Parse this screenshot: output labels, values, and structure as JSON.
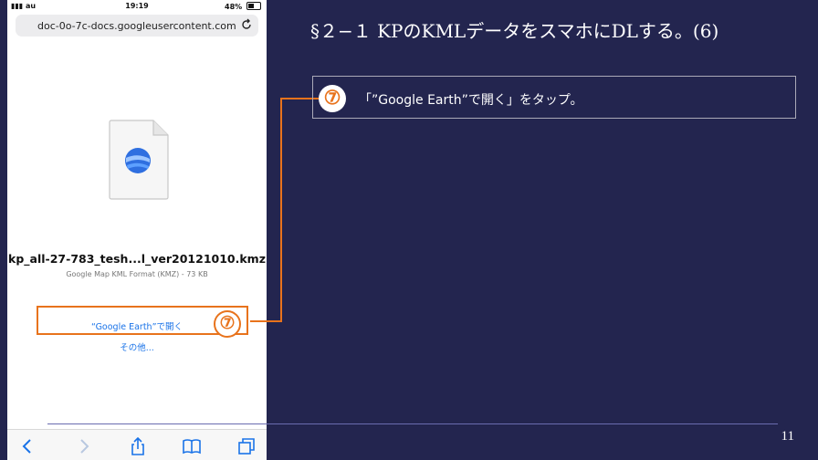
{
  "phone": {
    "status": {
      "carrier": "au",
      "time": "19:19",
      "battery": "48%",
      "battery_level": 0.48
    },
    "url": "doc-0o-7c-docs.googleusercontent.com",
    "file_name": "kp_all-27-783_tesh...l_ver20121010.kmz",
    "file_meta": "Google Map KML Format (KMZ) - 73 KB",
    "open_in_label": "“Google Earth”で開く",
    "more_label": "その他...",
    "icons": {
      "reload": "reload-icon",
      "back": "back-icon",
      "forward": "forward-icon",
      "share": "share-icon",
      "bookmarks": "bookmarks-icon",
      "tabs": "tabs-icon",
      "file": "google-earth-file-icon"
    }
  },
  "slide": {
    "title": "§２−１ KPのKMLデータをスマホにDLする。(6)",
    "step_marker": "⑦",
    "instruction": "「”Google Earth”で開く」をタップ。",
    "page_number": "11"
  },
  "colors": {
    "background": "#23254f",
    "accent": "#e8731c",
    "link": "#1a73e8"
  }
}
